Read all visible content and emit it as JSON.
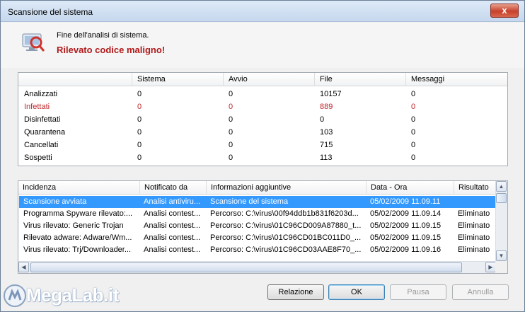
{
  "window": {
    "title": "Scansione del sistema",
    "close_label": "x"
  },
  "header": {
    "line1": "Fine dell'analisi di sistema.",
    "line2": "Rilevato codice maligno!"
  },
  "stats": {
    "columns": [
      "",
      "Sistema",
      "Avvio",
      "File",
      "Messaggi"
    ],
    "rows": [
      {
        "label": "Analizzati",
        "values": [
          "0",
          "0",
          "10157",
          "0"
        ],
        "highlight": false
      },
      {
        "label": "Infettati",
        "values": [
          "0",
          "0",
          "889",
          "0"
        ],
        "highlight": true
      },
      {
        "label": "Disinfettati",
        "values": [
          "0",
          "0",
          "0",
          "0"
        ],
        "highlight": false
      },
      {
        "label": "Quarantena",
        "values": [
          "0",
          "0",
          "103",
          "0"
        ],
        "highlight": false
      },
      {
        "label": "Cancellati",
        "values": [
          "0",
          "0",
          "715",
          "0"
        ],
        "highlight": false
      },
      {
        "label": "Sospetti",
        "values": [
          "0",
          "0",
          "113",
          "0"
        ],
        "highlight": false
      }
    ]
  },
  "events": {
    "columns": [
      "Incidenza",
      "Notificato da",
      "Informazioni aggiuntive",
      "Data - Ora",
      "Risultato"
    ],
    "rows": [
      {
        "cells": [
          "Scansione avviata",
          "Analisi antiviru...",
          "Scansione del sistema",
          "05/02/2009 11.09.11",
          ""
        ],
        "selected": true
      },
      {
        "cells": [
          "Programma Spyware rilevato:...",
          "Analisi contest...",
          "Percorso: C:\\virus\\00f94ddb1b831f6203d...",
          "05/02/2009 11.09.14",
          "Eliminato"
        ],
        "selected": false
      },
      {
        "cells": [
          "Virus rilevato: Generic Trojan",
          "Analisi contest...",
          "Percorso: C:\\virus\\01C96CD009A87880_t...",
          "05/02/2009 11.09.15",
          "Eliminato"
        ],
        "selected": false
      },
      {
        "cells": [
          "Rilevato adware: Adware/Wm...",
          "Analisi contest...",
          "Percorso: C:\\virus\\01C96CD01BC011D0_...",
          "05/02/2009 11.09.15",
          "Eliminato"
        ],
        "selected": false
      },
      {
        "cells": [
          "Virus rilevato: Trj/Downloader...",
          "Analisi contest...",
          "Percorso: C:\\virus\\01C96CD03AAE8F70_...",
          "05/02/2009 11.09.16",
          "Eliminato"
        ],
        "selected": false
      }
    ]
  },
  "buttons": {
    "report": "Relazione",
    "ok": "OK",
    "pause": "Pausa",
    "cancel": "Annulla"
  },
  "watermark": {
    "text": "MegaLab.it"
  },
  "colors": {
    "alert_red": "#b21a1a",
    "selection": "#3399ff"
  }
}
